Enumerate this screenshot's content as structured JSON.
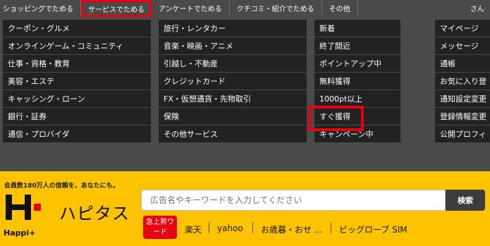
{
  "topnav": {
    "tabs": [
      {
        "label": "ショッピングでためる"
      },
      {
        "label": "サービスでためる"
      },
      {
        "label": "アンケートでためる"
      },
      {
        "label": "クチコミ・紹介でためる"
      },
      {
        "label": "その他"
      }
    ],
    "active_index": 1,
    "user_text": "さん"
  },
  "menu": {
    "col1": [
      "クーポン・グルメ",
      "オンラインゲーム・コミュニティ",
      "仕事・資格・教育",
      "美容・エステ",
      "キャッシング・ローン",
      "銀行・証券",
      "通信・プロバイダ"
    ],
    "col2": [
      "旅行・レンタカー",
      "音楽・映画・アニメ",
      "引越し・不動産",
      "クレジットカード",
      "FX・仮想通貨・先物取引",
      "保険",
      "その他サービス"
    ],
    "col3": [
      "新着",
      "終了間近",
      "ポイントアップ中",
      "無料獲得",
      "1000pt以上",
      "すぐ獲得",
      "キャンペーン中"
    ],
    "col4": [
      "マイページ",
      "メッセージ",
      "通帳",
      "お気に入り登",
      "通知設定変更",
      "登録情報変更",
      "公開プロフィ"
    ]
  },
  "footer": {
    "tagline": "会員数180万人の信頼を、あなたにも。",
    "logo_sub": "Happi+",
    "logo_name": "ハピタス",
    "search": {
      "placeholder": "広告名やキーワードを入力してください",
      "button_label": "検索"
    },
    "rising_label": "急上昇ワード",
    "keywords": [
      "楽天",
      "yahoo",
      "お歳暮・おせ ...",
      "ビッグローブ SIM"
    ]
  },
  "colors": {
    "accent": "#e60012",
    "footer_bg": "#fdc300",
    "menu_bg": "#222222",
    "page_bg": "#4a4a4a"
  }
}
